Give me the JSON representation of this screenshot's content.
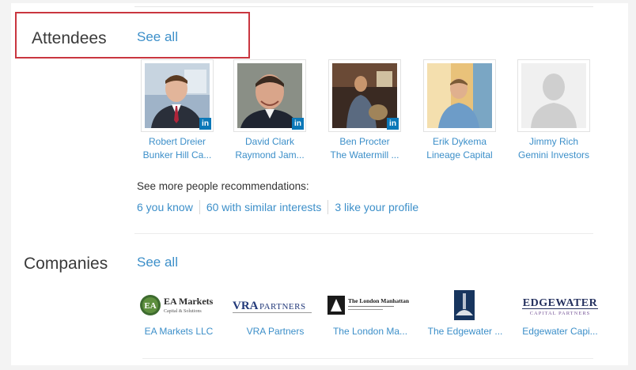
{
  "attendees": {
    "title": "Attendees",
    "see_all": "See all",
    "people": [
      {
        "name": "Robert Dreier",
        "company": "Bunker Hill Ca...",
        "linkedin_badge": "in"
      },
      {
        "name": "David Clark",
        "company": "Raymond Jam...",
        "linkedin_badge": "in"
      },
      {
        "name": "Ben Procter",
        "company": "The Watermill ...",
        "linkedin_badge": "in"
      },
      {
        "name": "Erik Dykema",
        "company": "Lineage Capital"
      },
      {
        "name": "Jimmy Rich",
        "company": "Gemini Investors"
      }
    ],
    "recommendations_label": "See more people recommendations:",
    "recommendations": [
      "6 you know",
      "60 with similar interests",
      "3 like your profile"
    ]
  },
  "companies": {
    "title": "Companies",
    "see_all": "See all",
    "items": [
      {
        "name": "EA Markets LLC",
        "logo_text": "EA Markets",
        "logo_sub": "Capital & Solutions",
        "logo_mark": "EA"
      },
      {
        "name": "VRA Partners",
        "logo_text": "VRA",
        "logo_text2": "PARTNERS"
      },
      {
        "name": "The London Ma...",
        "logo_text": "The London Manhattan"
      },
      {
        "name": "The Edgewater ..."
      },
      {
        "name": "Edgewater Capi...",
        "logo_text": "EDGEWATER",
        "logo_sub": "CAPITAL PARTNERS"
      }
    ]
  },
  "colors": {
    "link": "#3c8fc9",
    "highlight": "#c9363f",
    "linkedin": "#0b78b8"
  }
}
